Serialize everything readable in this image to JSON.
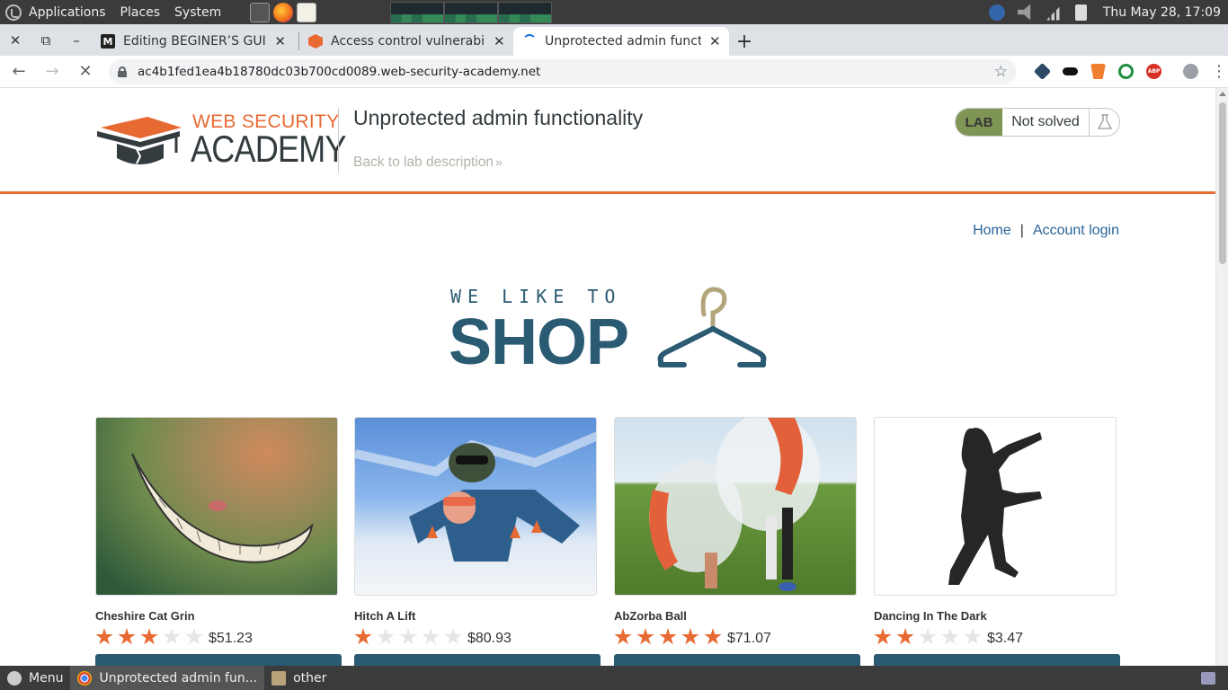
{
  "system_panel": {
    "menus": [
      "Applications",
      "Places",
      "System"
    ],
    "clock": "Thu May 28, 17:09"
  },
  "browser": {
    "tabs": [
      {
        "title": "Editing BEGINER’S GUI",
        "favicon": "medium-icon"
      },
      {
        "title": "Access control vulnerabili",
        "favicon": "portswigger-icon"
      },
      {
        "title": "Unprotected admin functi",
        "favicon": "loading-spinner-icon",
        "active": true
      }
    ],
    "url": "ac4b1fed1ea4b18780dc03b700cd0089.web-security-academy.net"
  },
  "academy": {
    "logo_top": "WEB SECURITY",
    "logo_bottom": "ACADEMY",
    "lab_title": "Unprotected admin functionality",
    "back_link": "Back to lab description",
    "lab_badge": "LAB",
    "lab_status": "Not solved",
    "accent_color": "#e86a33"
  },
  "shop_nav": {
    "home": "Home",
    "separator": "|",
    "account": "Account login"
  },
  "banner": {
    "line1": "WE LIKE TO",
    "line2": "SHOP"
  },
  "products": [
    {
      "name": "Cheshire Cat Grin",
      "rating": 3,
      "price": "$51.23"
    },
    {
      "name": "Hitch A Lift",
      "rating": 1,
      "price": "$80.93"
    },
    {
      "name": "AbZorba Ball",
      "rating": 5,
      "price": "$71.07"
    },
    {
      "name": "Dancing In The Dark",
      "rating": 2,
      "price": "$3.47"
    }
  ],
  "taskbar": {
    "menu": "Menu",
    "window": "Unprotected admin fun...",
    "folder": "other"
  }
}
